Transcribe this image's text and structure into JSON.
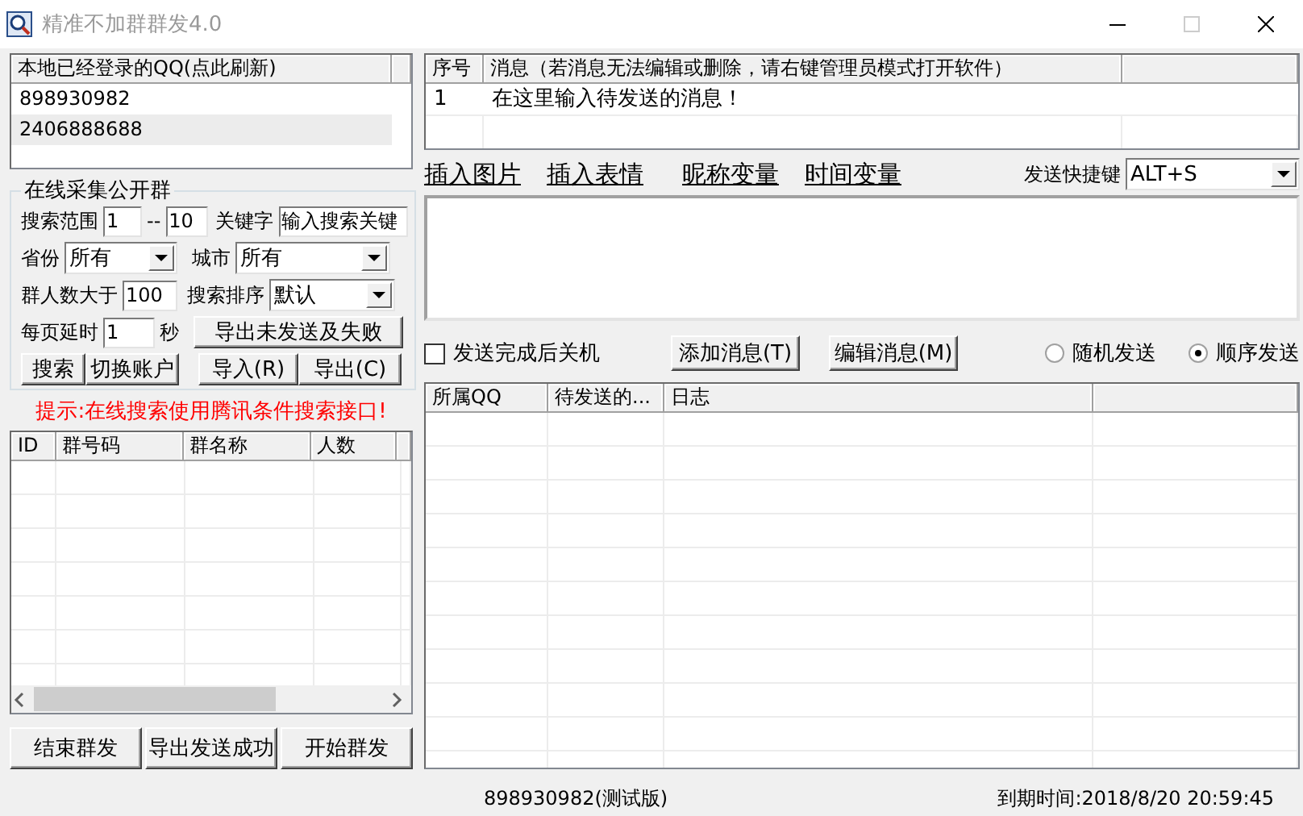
{
  "window": {
    "title": "精准不加群群发4.0"
  },
  "accounts": {
    "header": "本地已经登录的QQ(点此刷新)",
    "items": [
      {
        "label": "898930982",
        "selected": false
      },
      {
        "label": "2406888688",
        "selected": true
      }
    ]
  },
  "search": {
    "title": "在线采集公开群",
    "range_label": "搜索范围",
    "range_from": "1",
    "range_sep": "--",
    "range_to": "10",
    "keyword_label": "关键字",
    "keyword": "输入搜索关键",
    "province_label": "省份",
    "province": "所有",
    "city_label": "城市",
    "city": "所有",
    "members_label": "群人数大于",
    "members": "100",
    "sort_label": "搜索排序",
    "sort": "默认",
    "delay_label": "每页延时",
    "delay": "1",
    "delay_unit": "秒",
    "export_failed": "导出未发送及失败",
    "search_button": "搜索",
    "switch_button": "切换账户",
    "import_button": "导入(R)",
    "export_button": "导出(C)"
  },
  "hint": "提示:在线搜索使用腾讯条件搜索接口!",
  "groups_table": {
    "columns": [
      "ID",
      "群号码",
      "群名称",
      "人数"
    ]
  },
  "bottom_buttons": [
    "结束群发",
    "导出发送成功",
    "开始群发"
  ],
  "messages_table": {
    "columns": [
      "序号",
      "消息（若消息无法编辑或删除，请右键管理员模式打开软件）"
    ],
    "rows": [
      [
        "1",
        "在这里输入待发送的消息！"
      ]
    ]
  },
  "insert_links": [
    "插入图片",
    "插入表情",
    "昵称变量",
    "时间变量"
  ],
  "hotkey": {
    "label": "发送快捷键",
    "value": "ALT+S"
  },
  "options": {
    "shutdown": {
      "label": "发送完成后关机",
      "checked": false
    },
    "buttons": [
      "添加消息(T)",
      "编辑消息(M)"
    ],
    "send_modes": [
      {
        "label": "随机发送",
        "selected": false
      },
      {
        "label": "顺序发送",
        "selected": true
      }
    ]
  },
  "log_table": {
    "columns": [
      "所属QQ",
      "待发送的...",
      "日志"
    ]
  },
  "status_bar": [
    "898930982(测试版)",
    "到期时间:2018/8/20 20:59:45"
  ]
}
